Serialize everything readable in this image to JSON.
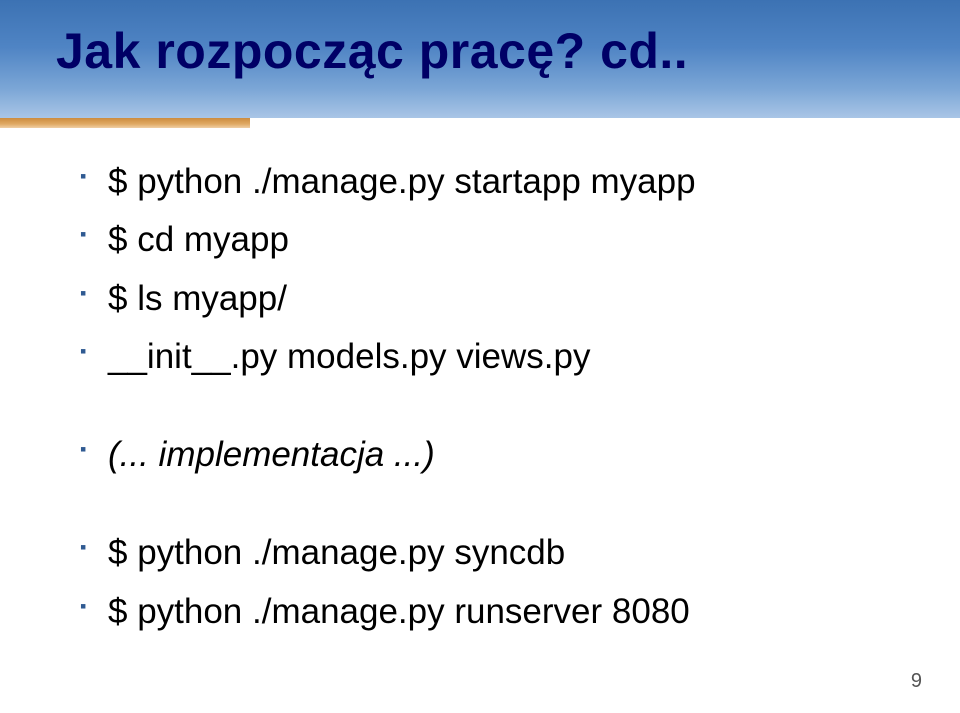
{
  "title": "Jak rozpocząc pracę? cd..",
  "bullets": {
    "b1": "$ python ./manage.py startapp myapp",
    "b2": "$ cd myapp",
    "b3": "$ ls myapp/",
    "b4": "__init__.py  models.py  views.py",
    "b5": "(... implementacja ...)",
    "b6": "$ python ./manage.py syncdb",
    "b7": "$ python ./manage.py runserver 8080"
  },
  "page_number": "9"
}
